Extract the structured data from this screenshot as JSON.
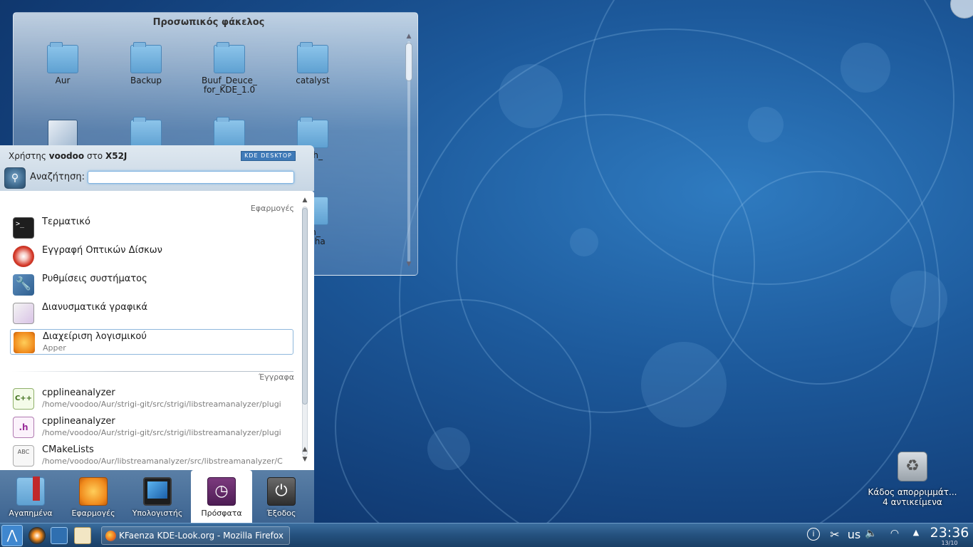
{
  "folderview": {
    "title": "Προσωπικός φάκελος",
    "items": [
      {
        "label": "Aur"
      },
      {
        "label": "Backup"
      },
      {
        "label": "Buuf_Deuce_\nfor_KDE_1.0"
      },
      {
        "label": "catalyst"
      },
      {
        "label": ""
      },
      {
        "label": ""
      },
      {
        "label": ""
      },
      {
        "label": "Fresh_\n2"
      },
      {
        "label": "_icon_\nby_tiha"
      }
    ]
  },
  "kickoff": {
    "user_prefix": "Χρήστης",
    "user_name": "voodoo",
    "user_mid": "στο",
    "host": "X52J",
    "badge": "KDE DESKTOP",
    "search_label": "Αναζήτηση:",
    "search_value": "",
    "section_apps": "Εφαρμογές",
    "section_docs": "Έγγραφα",
    "apps": [
      {
        "name": "Τερματικό",
        "sub": "",
        "icon": "terminal-icon"
      },
      {
        "name": "Εγγραφή Οπτικών Δίσκων",
        "sub": "",
        "icon": "disc-burner-icon"
      },
      {
        "name": "Ρυθμίσεις συστήματος",
        "sub": "",
        "icon": "system-settings-icon"
      },
      {
        "name": "Διανυσματικά γραφικά",
        "sub": "",
        "icon": "vector-graphics-icon"
      },
      {
        "name": "Διαχείριση λογισμικού",
        "sub": "Apper",
        "icon": "software-management-icon"
      }
    ],
    "docs": [
      {
        "name": "cpplineanalyzer",
        "sub": "/home/voodoo/Aur/strigi-git/src/strigi/libstreamanalyzer/plugi",
        "icon": "cpp-file-icon",
        "badge": "C++"
      },
      {
        "name": "cpplineanalyzer",
        "sub": "/home/voodoo/Aur/strigi-git/src/strigi/libstreamanalyzer/plugi",
        "icon": "header-file-icon",
        "badge": ".h"
      },
      {
        "name": "CMakeLists",
        "sub": "/home/voodoo/Aur/libstreamanalyzer/src/libstreamanalyzer/C",
        "icon": "text-file-icon",
        "badge": "ABC"
      }
    ],
    "tabs": [
      {
        "label": "Αγαπημένα",
        "icon": "favorites-icon"
      },
      {
        "label": "Εφαρμογές",
        "icon": "applications-icon"
      },
      {
        "label": "Υπολογιστής",
        "icon": "computer-icon"
      },
      {
        "label": "Πρόσφατα",
        "icon": "recent-icon"
      },
      {
        "label": "Έξοδος",
        "icon": "leave-icon"
      }
    ]
  },
  "trash": {
    "name": "Κάδος απορριμμάτ...",
    "count": "4 αντικείμενα"
  },
  "taskbar": {
    "task_title": "KFaenza KDE-Look.org - Mozilla Firefox",
    "keyboard_layout": "us",
    "time": "23:36",
    "date": "13/10"
  },
  "colors": {
    "accent": "#3f87cf",
    "highlight_border": "#8fb8dc",
    "taskbar": "#24507d"
  }
}
